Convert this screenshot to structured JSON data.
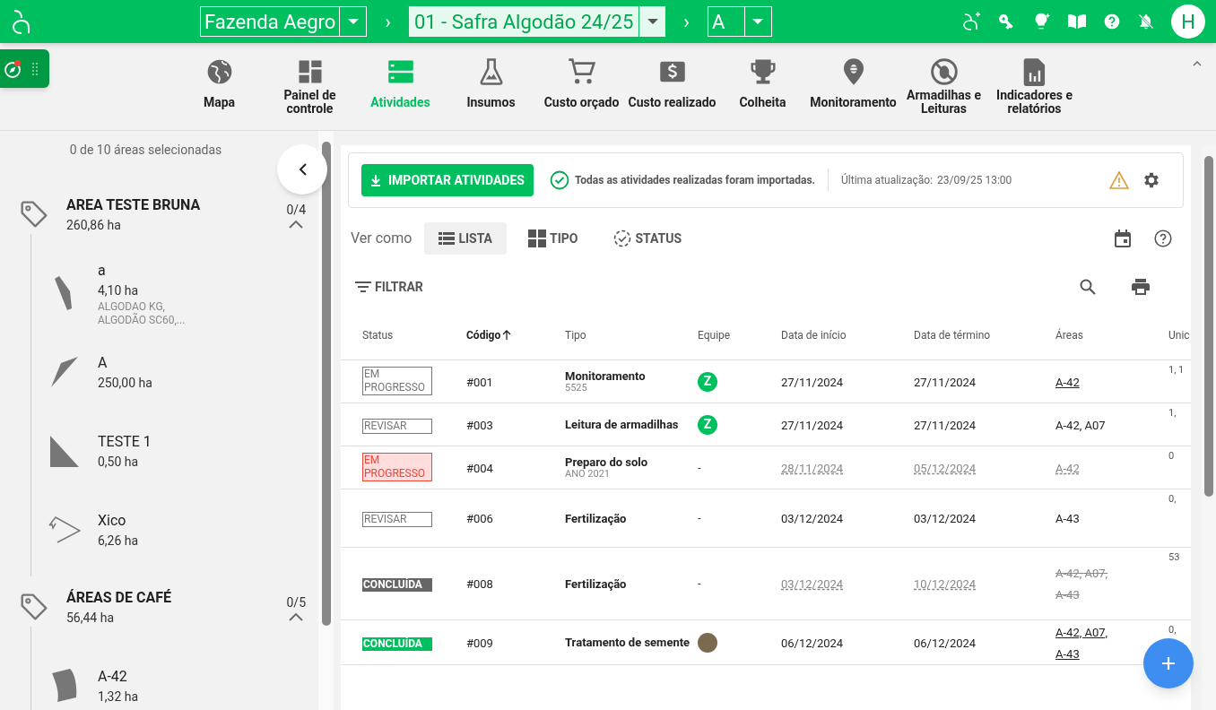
{
  "topbar": {
    "farm": "Fazenda Aegro",
    "separator_1": "›",
    "season": "01 - Safra Algodão 24/25",
    "separator_2": "›",
    "plot": "A",
    "avatar": "H"
  },
  "nav": [
    {
      "label": "Mapa",
      "selected": false
    },
    {
      "label": "Painel de controle",
      "selected": false
    },
    {
      "label": "Atividades",
      "selected": true
    },
    {
      "label": "Insumos",
      "selected": false
    },
    {
      "label": "Custo orçado",
      "selected": false
    },
    {
      "label": "Custo realizado",
      "selected": false
    },
    {
      "label": "Colheita",
      "selected": false
    },
    {
      "label": "Monitoramento",
      "selected": false
    },
    {
      "label": "Armadilhas e Leituras",
      "selected": false
    },
    {
      "label": "Indicadores e relatórios",
      "selected": false
    }
  ],
  "sidebar": {
    "summary": "0 de 10 áreas selecionadas",
    "groups": [
      {
        "name": "AREA TESTE BRUNA",
        "area": "260,86 ha",
        "count": "0/4",
        "expanded": true,
        "children": [
          {
            "kind": "strip",
            "name": "a",
            "area": "4,10 ha",
            "crops": "ALGODAO KG, ALGODÃO SC60,..."
          },
          {
            "kind": "wedge",
            "name": "A",
            "area": "250,00 ha"
          },
          {
            "kind": "triangle",
            "name": "TESTE 1",
            "area": "0,50 ha"
          },
          {
            "kind": "outline",
            "name": "Xico",
            "area": "6,26 ha"
          }
        ]
      },
      {
        "name": "ÁREAS DE CAFÉ",
        "area": "56,44 ha",
        "count": "0/5",
        "expanded": true,
        "children": [
          {
            "kind": "blob",
            "name": "A-42",
            "area": "1,32 ha"
          }
        ]
      }
    ]
  },
  "import_bar": {
    "button": "IMPORTAR ATIVIDADES",
    "message": "Todas as atividades realizadas foram importadas.",
    "updated_label": "Última atualização:",
    "updated_value": "23/09/25 13:00"
  },
  "view": {
    "label": "Ver como",
    "options": [
      {
        "label": "LISTA",
        "selected": true
      },
      {
        "label": "TIPO",
        "selected": false
      },
      {
        "label": "STATUS",
        "selected": false
      }
    ]
  },
  "filter": "FILTRAR",
  "table": {
    "columns": [
      {
        "label": "Status",
        "sorted": false
      },
      {
        "label": "Código",
        "sorted": true
      },
      {
        "label": "Tipo",
        "sorted": false
      },
      {
        "label": "Equipe",
        "sorted": false
      },
      {
        "label": "Data de início",
        "sorted": false
      },
      {
        "label": "Data de término",
        "sorted": false
      },
      {
        "label": "Áreas",
        "sorted": false
      },
      {
        "label": "Unic",
        "sorted": false
      }
    ],
    "rows": [
      {
        "status": {
          "text": "EM PROGRESSO",
          "kind": "outline"
        },
        "code": "#001",
        "type": "Monitoramento",
        "subtitle": "5525",
        "team": {
          "kind": "letter",
          "text": "Z"
        },
        "start": "27/11/2024",
        "end": "27/11/2024",
        "dates_dashed": false,
        "areas": {
          "text": "A-42",
          "kind": "link"
        },
        "column_8": "1, 1"
      },
      {
        "status": {
          "text": "REVISAR",
          "kind": "outline"
        },
        "code": "#003",
        "type": "Leitura de armadilhas",
        "team": {
          "kind": "letter",
          "text": "Z"
        },
        "start": "27/11/2024",
        "end": "27/11/2024",
        "dates_dashed": false,
        "areas": {
          "text": "A-42, A07",
          "kind": "plain"
        },
        "column_8": "1,"
      },
      {
        "status": {
          "text": "EM PROGRESSO",
          "kind": "late"
        },
        "code": "#004",
        "type": "Preparo do solo",
        "subtitle": "ANO 2021",
        "team": {
          "kind": "none",
          "text": "-"
        },
        "start": "28/11/2024",
        "end": "05/12/2024",
        "dates_dashed": true,
        "areas": {
          "text": "A-42",
          "kind": "dashed"
        },
        "column_8": "0"
      },
      {
        "status": {
          "text": "REVISAR",
          "kind": "outline"
        },
        "code": "#006",
        "type": "Fertilização",
        "team": {
          "kind": "none",
          "text": "-"
        },
        "start": "03/12/2024",
        "end": "03/12/2024",
        "dates_dashed": false,
        "areas": {
          "text": "A-43",
          "kind": "plain"
        },
        "column_8": "0,"
      },
      {
        "status": {
          "text": "CONCLUÍDA",
          "kind": "grey"
        },
        "code": "#008",
        "type": "Fertilização",
        "team": {
          "kind": "none",
          "text": "-"
        },
        "start": "03/12/2024",
        "end": "10/12/2024",
        "dates_dashed": true,
        "areas": {
          "text": "A-42, A07, A-43",
          "kind": "strike"
        },
        "column_8": "53"
      },
      {
        "status": {
          "text": "CONCLUÍDA",
          "kind": "green"
        },
        "code": "#009",
        "type": "Tratamento de semente",
        "team": {
          "kind": "photo"
        },
        "start": "06/12/2024",
        "end": "06/12/2024",
        "dates_dashed": false,
        "areas": {
          "text": "A-42, A07, A-43",
          "kind": "link"
        },
        "column_8": "0,"
      }
    ]
  }
}
